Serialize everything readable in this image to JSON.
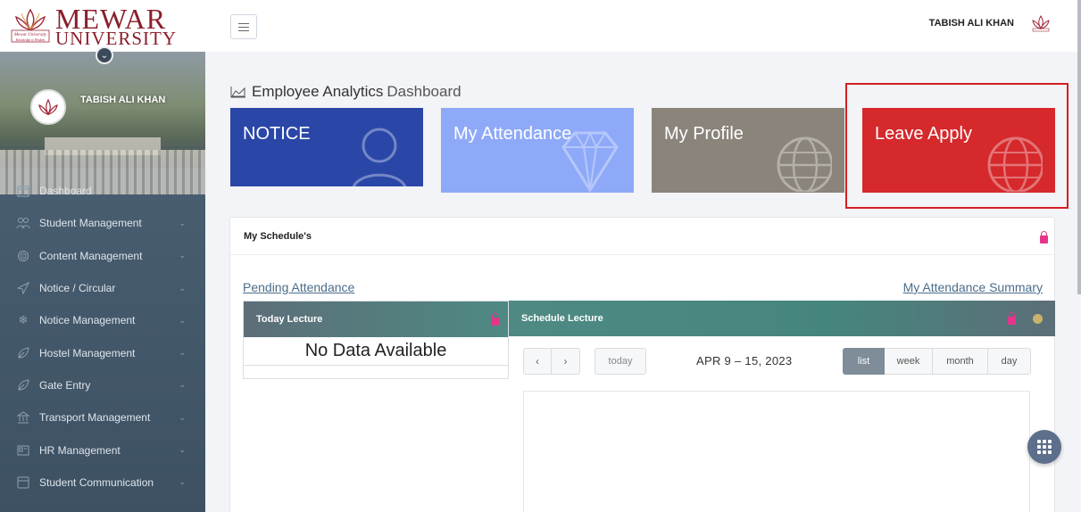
{
  "brand": {
    "logo_line1": "MEWAR",
    "logo_line2": "UNIVERSITY",
    "logo_tag": "Mewar University",
    "logo_motto": "Knowledge to Wisdom",
    "accent_color": "#8a1e2b"
  },
  "sidebar": {
    "user_name": "TABISH ALI KHAN",
    "items": [
      {
        "label": "Dashboard",
        "icon": "calendar-icon",
        "expandable": false
      },
      {
        "label": "Student Management",
        "icon": "users-icon",
        "expandable": true
      },
      {
        "label": "Content Management",
        "icon": "fingerprint-icon",
        "expandable": true
      },
      {
        "label": "Notice / Circular",
        "icon": "send-icon",
        "expandable": true
      },
      {
        "label": "Notice Management",
        "icon": "snowflake-icon",
        "expandable": true
      },
      {
        "label": "Hostel Management",
        "icon": "leaf-icon",
        "expandable": true
      },
      {
        "label": "Gate Entry",
        "icon": "leaf-icon",
        "expandable": true
      },
      {
        "label": "Transport Management",
        "icon": "bank-icon",
        "expandable": true
      },
      {
        "label": "HR Management",
        "icon": "id-card-icon",
        "expandable": true
      },
      {
        "label": "Student Communication",
        "icon": "chat-icon",
        "expandable": true
      }
    ]
  },
  "topbar": {
    "user_name": "TABISH ALI KHAN"
  },
  "page": {
    "title_bold": "Employee Analytics",
    "title_light": "Dashboard"
  },
  "tiles": [
    {
      "label": "NOTICE",
      "color": "#2a47a8",
      "icon": "user-icon"
    },
    {
      "label": "My Attendance",
      "color": "#8ea9f8",
      "icon": "diamond-icon"
    },
    {
      "label": "My Profile",
      "color": "#8b847b",
      "icon": "globe-icon"
    },
    {
      "label": "Leave Apply",
      "color": "#d5292c",
      "icon": "globe-icon"
    }
  ],
  "schedule": {
    "title": "My Schedule's",
    "pending_link": "Pending Attendance",
    "summary_link": "My Attendance Summary",
    "today_panel": {
      "title": "Today Lecture",
      "empty_text": "No Data Available"
    },
    "schedule_panel": {
      "title": "Schedule Lecture",
      "today_label": "today",
      "date_range": "APR 9 – 15, 2023",
      "views": [
        "list",
        "week",
        "month",
        "day"
      ],
      "active_view": "list"
    }
  }
}
